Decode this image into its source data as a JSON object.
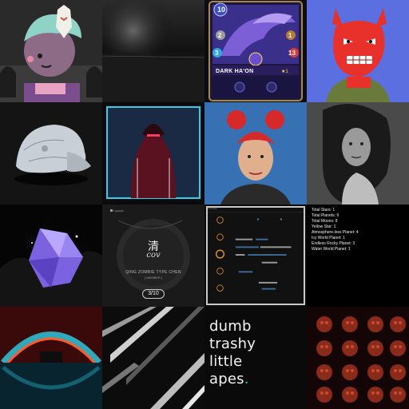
{
  "gallery": {
    "tiles": [
      {
        "kind": "image",
        "icon": "masked-character-icon"
      },
      {
        "kind": "image",
        "icon": "dark-landscape-icon"
      },
      {
        "kind": "card",
        "icon": "dragon-card-icon"
      },
      {
        "kind": "image",
        "icon": "red-demon-icon"
      },
      {
        "kind": "image",
        "icon": "silver-cap-icon"
      },
      {
        "kind": "image",
        "icon": "hooded-figure-icon"
      },
      {
        "kind": "image",
        "icon": "red-hair-portrait-icon"
      },
      {
        "kind": "image",
        "icon": "woman-portrait-icon"
      },
      {
        "kind": "image",
        "icon": "purple-crystal-icon"
      },
      {
        "kind": "album",
        "icon": "album-cover-icon"
      },
      {
        "kind": "dashboard",
        "icon": "dashboard-icon"
      },
      {
        "kind": "stats",
        "icon": "stats-list-icon"
      },
      {
        "kind": "image",
        "icon": "neon-arch-icon"
      },
      {
        "kind": "image",
        "icon": "abstract-lines-icon"
      },
      {
        "kind": "text",
        "icon": "text-icon"
      },
      {
        "kind": "image",
        "icon": "skulls-grid-icon"
      }
    ]
  },
  "card": {
    "name": "DARK HA'ON",
    "stars": "★1",
    "mana": "10",
    "left_stat": "2",
    "right_stat": "1",
    "speed": "3",
    "health": "13"
  },
  "album": {
    "label": "Tuplelabs",
    "glyph": "清",
    "logo": "cov",
    "artist": "QING ZOMBIE TYPE CHEN",
    "subtitle": "[ MEMBER ]",
    "edition": "3/10"
  },
  "dashboard": {
    "title": "overview"
  },
  "stats": {
    "lines": [
      "Total Stars: 1",
      "Total Planets: 9",
      "Total Moons: 8",
      "Yellow Star: 1",
      "Atmosphere-less Planet: 4",
      "Icy World Planet: 1",
      "Endless Rocky Planet: 3",
      "Water World Planet: 1"
    ]
  },
  "text_tile": {
    "lines": [
      "dumb",
      "trashy",
      "little",
      "apes"
    ],
    "end_mark": "."
  },
  "colors": {
    "background": "#000000",
    "accent_green": "#2fd487",
    "card_purple": "#5b3fa8",
    "demon_red": "#e8312a",
    "demon_bg": "#5b6fe0"
  }
}
